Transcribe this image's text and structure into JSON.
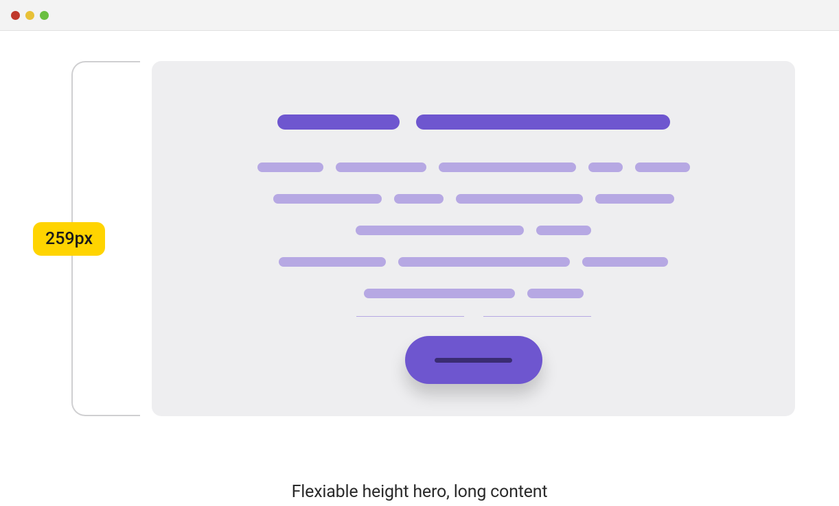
{
  "window": {
    "traffic_lights": [
      "close",
      "minimize",
      "zoom"
    ]
  },
  "measurement": {
    "label": "259px"
  },
  "caption": "Flexiable height hero, long content",
  "colors": {
    "accent": "#6e56cf",
    "accent_light": "#b6a8e3",
    "accent_dark": "#3a2c72",
    "badge_bg": "#ffd400",
    "card_bg": "#eeeef0"
  },
  "skeleton": {
    "heading_widths": [
      178,
      370
    ],
    "body_rows": [
      [
        96,
        132,
        200,
        50,
        80
      ],
      [
        158,
        72,
        185,
        115
      ],
      [
        245,
        80
      ],
      [
        156,
        250,
        125
      ],
      [
        220,
        82
      ]
    ],
    "underline_widths": [
      157,
      157
    ]
  }
}
